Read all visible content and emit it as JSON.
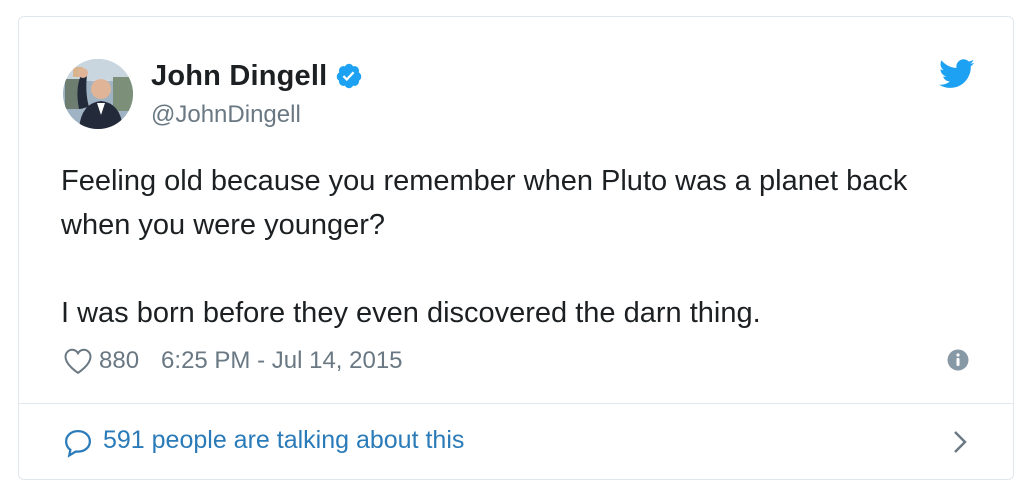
{
  "author": {
    "display_name": "John Dingell",
    "handle": "@JohnDingell",
    "verified": true
  },
  "tweet": {
    "paragraphs": [
      "Feeling old because you remember when Pluto was a planet back when you were younger?",
      "I was born before they even discovered the darn thing."
    ],
    "like_count": "880",
    "timestamp": "6:25 PM - Jul 14, 2015"
  },
  "conversation": {
    "label": "591 people are talking about this"
  },
  "icons": {
    "verified": "verified-badge-icon",
    "brand": "twitter-bird-icon",
    "like": "heart-icon",
    "info": "info-icon",
    "reply": "speech-bubble-icon",
    "more": "chevron-right-icon"
  },
  "colors": {
    "text": "#1c2022",
    "secondary": "#697882",
    "link": "#2b7bb9",
    "twitter_blue": "#1da1f2",
    "border": "#e1e8ed"
  }
}
